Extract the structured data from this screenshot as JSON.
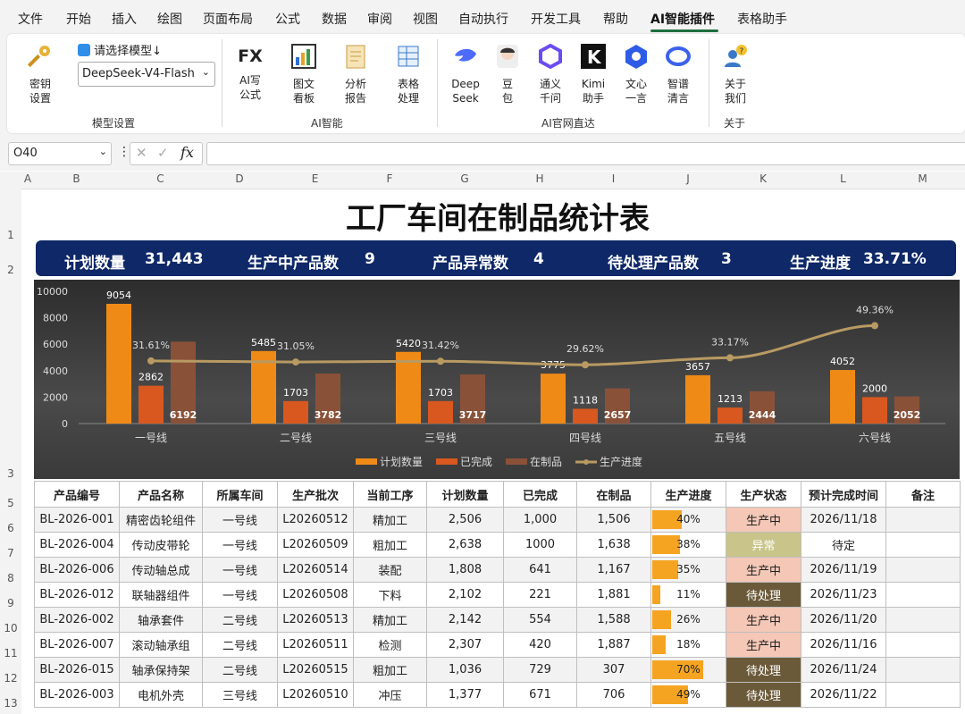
{
  "menu": [
    "文件",
    "开始",
    "插入",
    "绘图",
    "页面布局",
    "公式",
    "数据",
    "审阅",
    "视图",
    "自动执行",
    "开发工具",
    "帮助",
    "AI智能插件",
    "表格助手"
  ],
  "ribbon": {
    "key_btn": [
      "密钥",
      "设置"
    ],
    "model_prompt": "请选择模型↓",
    "model_value": "DeepSeek-V4-Flash",
    "group_model": "模型设置",
    "ai_btns": [
      [
        "AI写",
        "公式"
      ],
      [
        "图文",
        "看板"
      ],
      [
        "分析",
        "报告"
      ],
      [
        "表格",
        "处理"
      ]
    ],
    "fx_label": "FX",
    "group_ai": "AI智能",
    "site_btns": [
      [
        "Deep",
        "Seek"
      ],
      [
        "豆",
        "包"
      ],
      [
        "通义",
        "千问"
      ],
      [
        "Kimi",
        "助手"
      ],
      [
        "文心",
        "一言"
      ],
      [
        "智谱",
        "清言"
      ]
    ],
    "group_site": "AI官网直达",
    "about_btn": [
      "关于",
      "我们"
    ],
    "group_about": "关于"
  },
  "namebox": "O40",
  "col_headers": [
    "A",
    "B",
    "C",
    "D",
    "E",
    "F",
    "G",
    "H",
    "I",
    "J",
    "K",
    "L",
    "M"
  ],
  "row_headers": [
    "1",
    "2",
    "3",
    "5",
    "6",
    "7",
    "8",
    "9",
    "10",
    "11",
    "12",
    "13"
  ],
  "sheet": {
    "title": "工厂车间在制品统计表",
    "kpis": [
      {
        "label": "计划数量",
        "value": "31,443"
      },
      {
        "label": "生产中产品数",
        "value": "9"
      },
      {
        "label": "产品异常数",
        "value": "4"
      },
      {
        "label": "待处理产品数",
        "value": "3"
      },
      {
        "label": "生产进度",
        "value": "33.71%"
      }
    ]
  },
  "chart_data": {
    "type": "bar",
    "categories": [
      "一号线",
      "二号线",
      "三号线",
      "四号线",
      "五号线",
      "六号线"
    ],
    "series": [
      {
        "name": "计划数量",
        "values": [
          9054,
          5485,
          5420,
          3775,
          3657,
          4052
        ],
        "color": "#f08a17"
      },
      {
        "name": "已完成",
        "values": [
          2862,
          1703,
          1703,
          1118,
          1213,
          2000
        ],
        "color": "#d9581f"
      },
      {
        "name": "在制品",
        "values": [
          6192,
          3782,
          3717,
          2657,
          2444,
          2052
        ],
        "color": "#8a5139"
      },
      {
        "name": "生产进度",
        "type": "line",
        "values": [
          31.61,
          31.05,
          31.42,
          29.62,
          33.17,
          49.36
        ],
        "labels": [
          "31.61%",
          "31.05%",
          "31.42%",
          "29.62%",
          "33.17%",
          "49.36%"
        ],
        "color": "#b89a62"
      }
    ],
    "yticks": [
      0,
      2000,
      4000,
      6000,
      8000,
      10000
    ],
    "ylim": [
      0,
      10000
    ],
    "legend": "bottom"
  },
  "table": {
    "headers": [
      "产品编号",
      "产品名称",
      "所属车间",
      "生产批次",
      "当前工序",
      "计划数量",
      "已完成",
      "在制品",
      "生产进度",
      "生产状态",
      "预计完成时间",
      "备注"
    ],
    "rows": [
      [
        "BL-2026-001",
        "精密齿轮组件",
        "一号线",
        "L20260512",
        "精加工",
        "2,506",
        "1,000",
        "1,506",
        "40%",
        "生产中",
        "2026/11/18",
        ""
      ],
      [
        "BL-2026-004",
        "传动皮带轮",
        "一号线",
        "L20260509",
        "粗加工",
        "2,638",
        "1000",
        "1,638",
        "38%",
        "异常",
        "待定",
        ""
      ],
      [
        "BL-2026-006",
        "传动轴总成",
        "一号线",
        "L20260514",
        "装配",
        "1,808",
        "641",
        "1,167",
        "35%",
        "生产中",
        "2026/11/19",
        ""
      ],
      [
        "BL-2026-012",
        "联轴器组件",
        "一号线",
        "L20260508",
        "下料",
        "2,102",
        "221",
        "1,881",
        "11%",
        "待处理",
        "2026/11/23",
        ""
      ],
      [
        "BL-2026-002",
        "轴承套件",
        "二号线",
        "L20260513",
        "精加工",
        "2,142",
        "554",
        "1,588",
        "26%",
        "生产中",
        "2026/11/20",
        ""
      ],
      [
        "BL-2026-007",
        "滚动轴承组",
        "二号线",
        "L20260511",
        "检测",
        "2,307",
        "420",
        "1,887",
        "18%",
        "生产中",
        "2026/11/16",
        ""
      ],
      [
        "BL-2026-015",
        "轴承保持架",
        "二号线",
        "L20260515",
        "粗加工",
        "1,036",
        "729",
        "307",
        "70%",
        "待处理",
        "2026/11/24",
        ""
      ],
      [
        "BL-2026-003",
        "电机外壳",
        "三号线",
        "L20260510",
        "冲压",
        "1,377",
        "671",
        "706",
        "49%",
        "待处理",
        "2026/11/22",
        ""
      ]
    ],
    "progress": [
      0.4,
      0.38,
      0.35,
      0.11,
      0.26,
      0.18,
      0.7,
      0.49
    ]
  }
}
